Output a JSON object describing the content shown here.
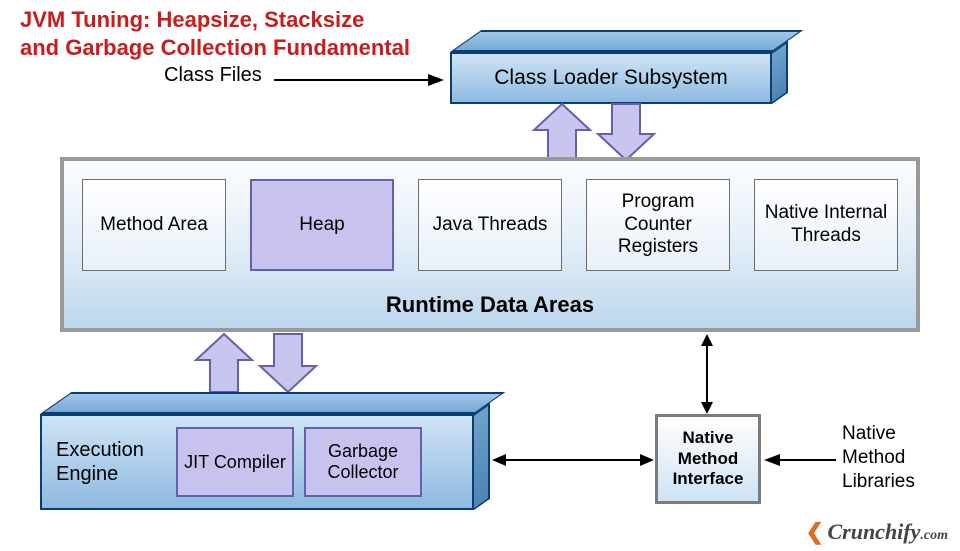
{
  "title_line1": "JVM Tuning: Heapsize, Stacksize",
  "title_line2": "and Garbage Collection Fundamental",
  "class_files_label": "Class Files",
  "class_loader_label": "Class Loader Subsystem",
  "rda": {
    "title": "Runtime Data Areas",
    "boxes": {
      "method_area": "Method Area",
      "heap": "Heap",
      "java_threads": "Java Threads",
      "pc_registers": "Program Counter Registers",
      "native_threads": "Native Internal Threads"
    }
  },
  "exec_engine": {
    "label": "Execution Engine",
    "jit": "JIT Compiler",
    "gc": "Garbage Collector"
  },
  "nmi_label": "Native Method Interface",
  "nml_label": "Native Method Libraries",
  "logo": {
    "brand": "Crunchify",
    "suffix": ".com"
  }
}
